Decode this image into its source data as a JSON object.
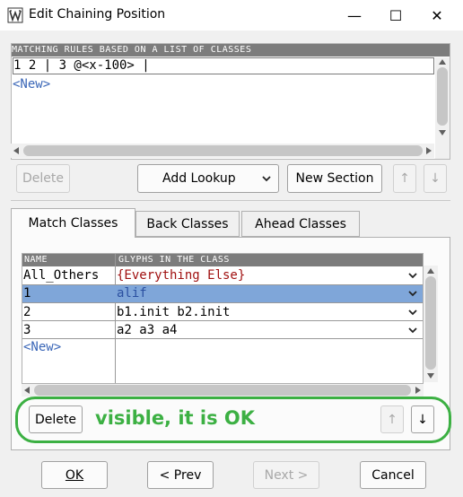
{
  "window": {
    "title": "Edit Chaining Position",
    "minimize": "—",
    "maximize": "☐",
    "close": "✕"
  },
  "rules": {
    "header": "Matching rules based on a list of classes",
    "line": "1 2 | 3 @<x-100> |",
    "new_item": "<New>"
  },
  "top_buttons": {
    "delete": "Delete",
    "add_lookup": "Add Lookup",
    "new_section": "New Section",
    "up": "↑",
    "down": "↓"
  },
  "tabs": [
    {
      "label": "Match Classes",
      "active": true
    },
    {
      "label": "Back Classes",
      "active": false
    },
    {
      "label": "Ahead Classes",
      "active": false
    }
  ],
  "classes": {
    "col_name": "Name",
    "col_glyphs": "Glyphs in the class",
    "rows": [
      {
        "name": "All_Others",
        "glyphs": "{Everything Else}",
        "selected": false,
        "special": true
      },
      {
        "name": "1",
        "glyphs": "alif",
        "selected": true,
        "special": false
      },
      {
        "name": "2",
        "glyphs": "b1.init b2.init",
        "selected": false,
        "special": false
      },
      {
        "name": "3",
        "glyphs": "a2 a3 a4",
        "selected": false,
        "special": false
      }
    ],
    "new_item": "<New>"
  },
  "panel_buttons": {
    "delete": "Delete",
    "up": "↑",
    "down": "↓"
  },
  "annotation": "visible, it is OK",
  "footer": {
    "ok": "OK",
    "prev": "< Prev",
    "next": "Next >",
    "cancel": "Cancel"
  },
  "colors": {
    "selection": "#7fa6d9",
    "special_text": "#a01010",
    "new_text": "#3a66b7",
    "annotation": "#3cb043"
  }
}
